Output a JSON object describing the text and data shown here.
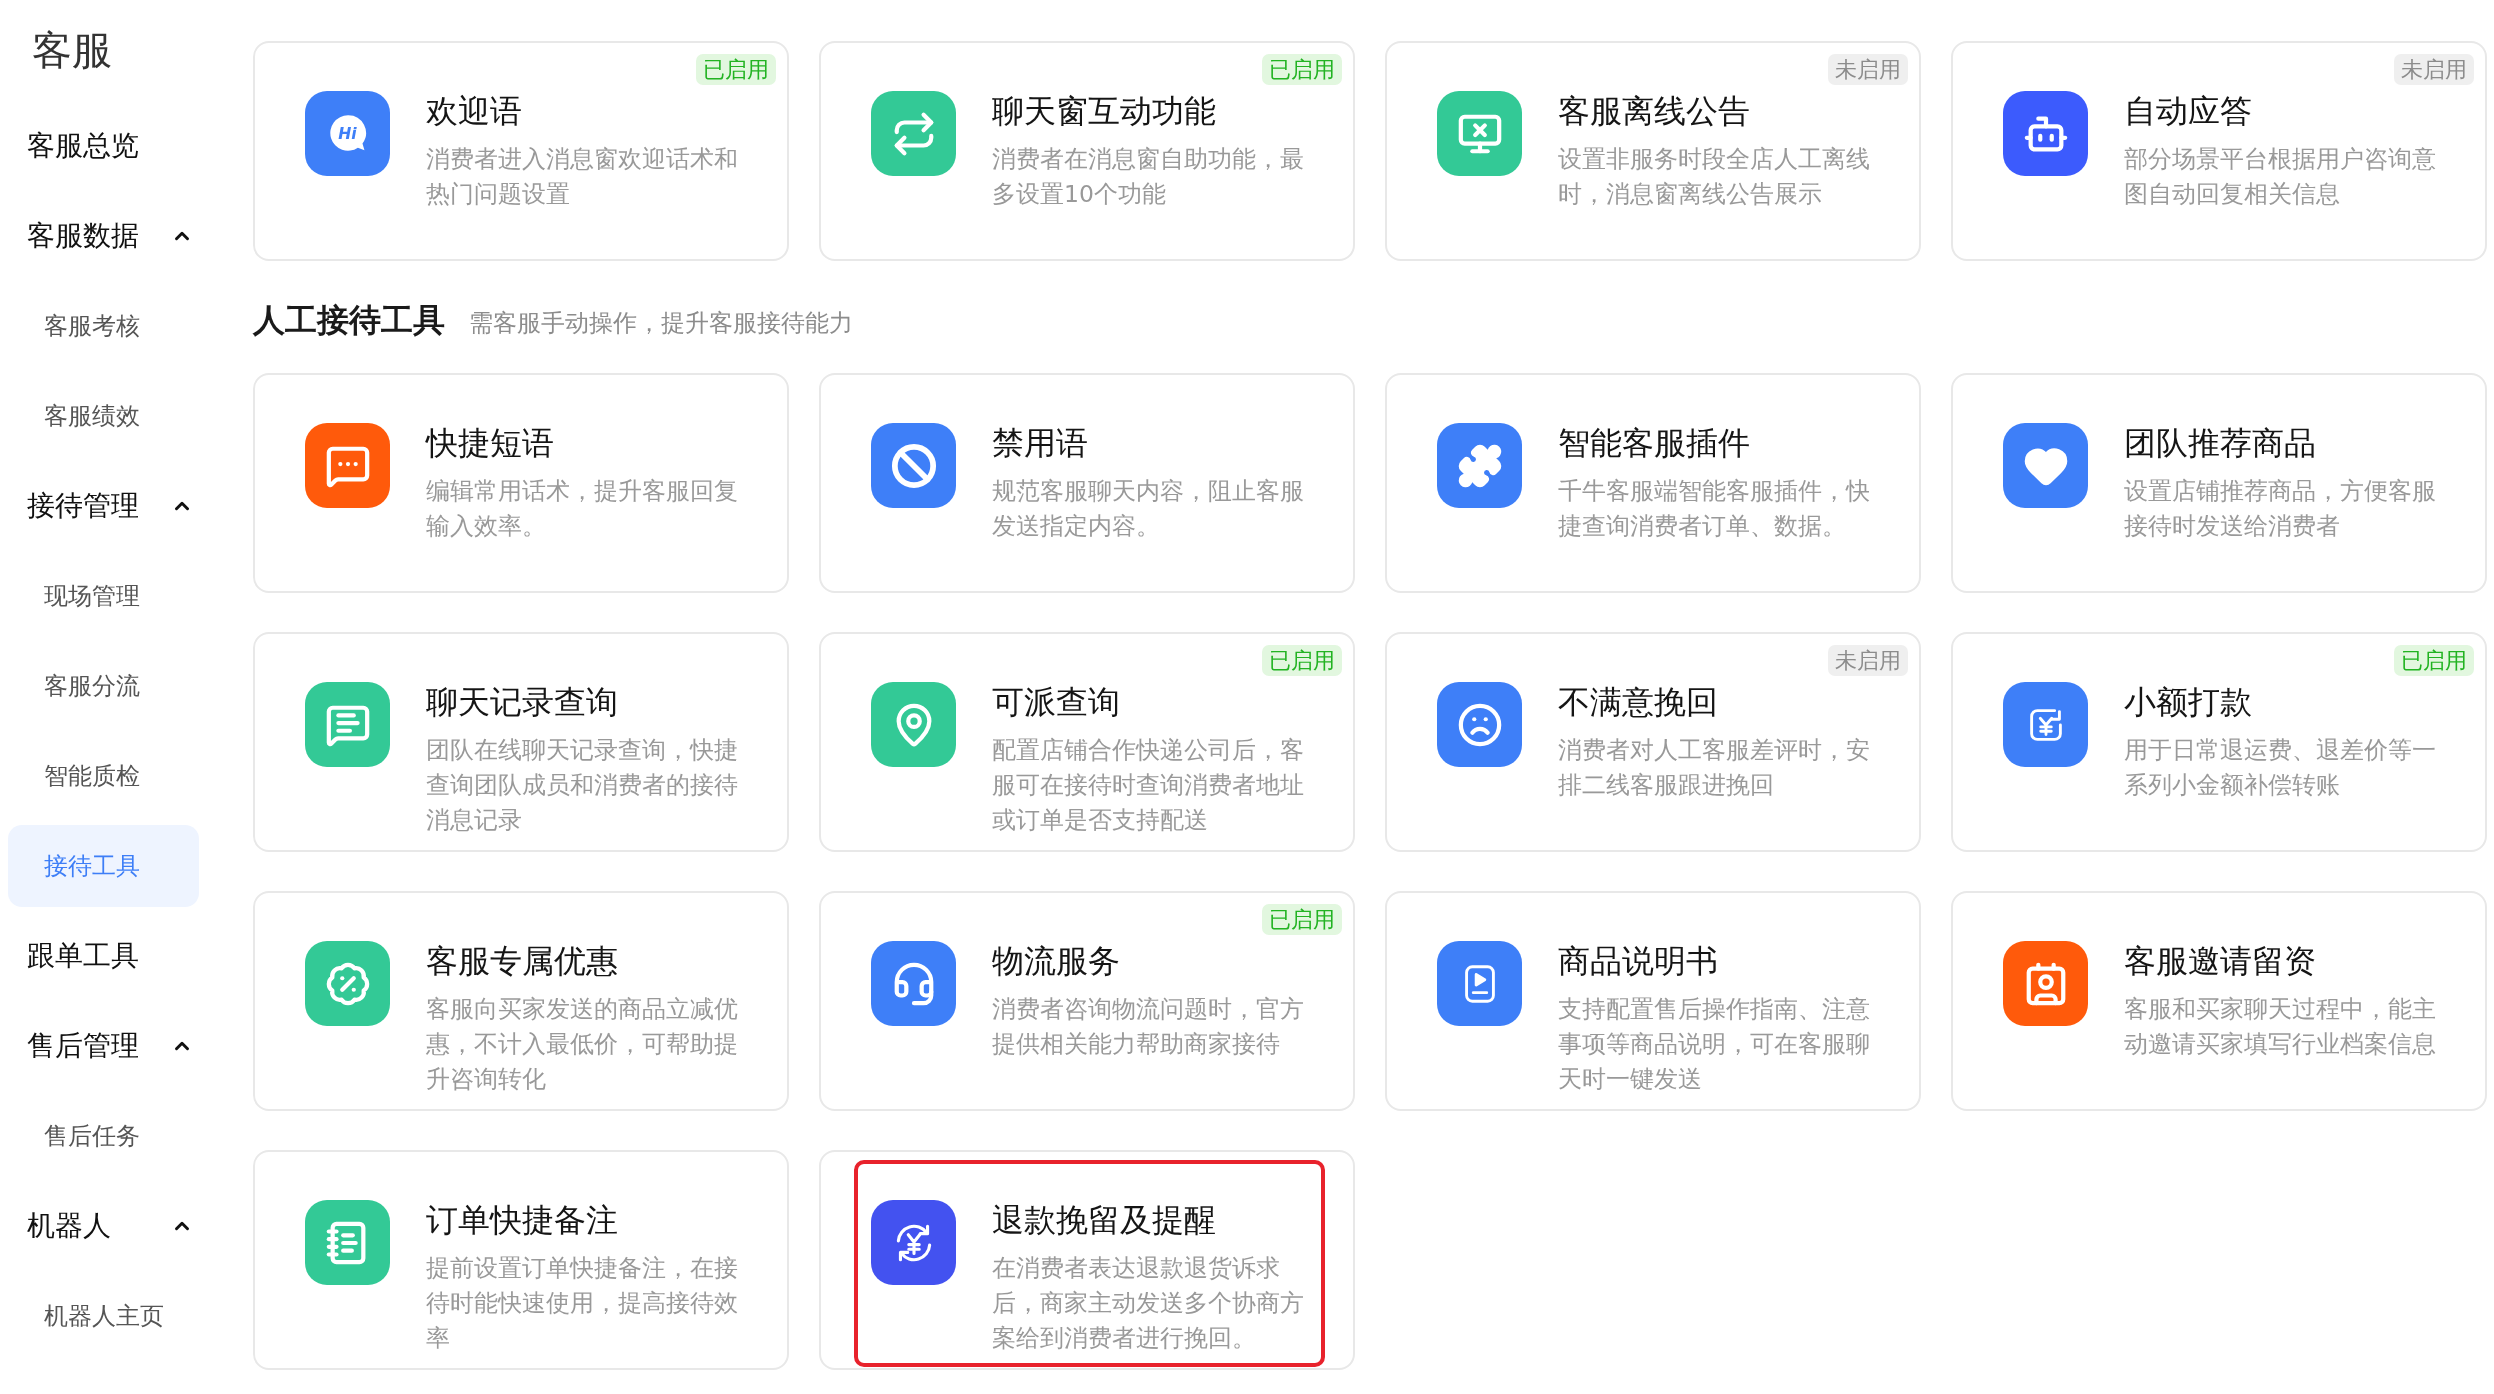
{
  "sidebar": {
    "title": "客服",
    "items": [
      {
        "kind": "link",
        "label": "客服总览",
        "selected": false
      },
      {
        "kind": "group",
        "label": "客服数据",
        "expanded": true,
        "children": [
          {
            "kind": "link",
            "label": "客服考核",
            "selected": false
          },
          {
            "kind": "link",
            "label": "客服绩效",
            "selected": false
          }
        ]
      },
      {
        "kind": "group",
        "label": "接待管理",
        "expanded": true,
        "children": [
          {
            "kind": "link",
            "label": "现场管理",
            "selected": false
          },
          {
            "kind": "link",
            "label": "客服分流",
            "selected": false
          },
          {
            "kind": "link",
            "label": "智能质检",
            "selected": false
          },
          {
            "kind": "link",
            "label": "接待工具",
            "selected": true
          }
        ]
      },
      {
        "kind": "link",
        "label": "跟单工具",
        "selected": false
      },
      {
        "kind": "group",
        "label": "售后管理",
        "expanded": true,
        "children": [
          {
            "kind": "link",
            "label": "售后任务",
            "selected": false
          }
        ]
      },
      {
        "kind": "group",
        "label": "机器人",
        "expanded": true,
        "children": [
          {
            "kind": "link",
            "label": "机器人主页",
            "selected": false
          }
        ]
      }
    ]
  },
  "auto_tools": [
    {
      "title": "欢迎语",
      "description": "消费者进入消息窗欢迎话术和热门问题设置",
      "color": "#3e7ff8",
      "icon_text": "Hi",
      "badge": "已启用",
      "enabled": true
    },
    {
      "title": "聊天窗互动功能",
      "description": "消费者在消息窗自助功能，最多设置10个功能",
      "color": "#33c996",
      "badge": "已启用",
      "enabled": true
    },
    {
      "title": "客服离线公告",
      "description": "设置非服务时段全店人工离线时，消息窗离线公告展示",
      "color": "#33c996",
      "badge": "未启用",
      "enabled": false
    },
    {
      "title": "自动应答",
      "description": "部分场景平台根据用户咨询意图自动回复相关信息",
      "color": "#3c5bfd",
      "badge": "未启用",
      "enabled": false
    }
  ],
  "manual_tools": {
    "title": "人工接待工具",
    "subtitle": "需客服手动操作，提升客服接待能力",
    "tools": [
      {
        "title": "快捷短语",
        "description": "编辑常用话术，提升客服回复输入效率。",
        "color": "#ff5a0b",
        "highlighted": false
      },
      {
        "title": "禁用语",
        "description": "规范客服聊天内容，阻止客服发送指定内容。",
        "color": "#3e7ff8",
        "highlighted": false
      },
      {
        "title": "智能客服插件",
        "description": "千牛客服端智能客服插件，快捷查询消费者订单、数据。",
        "color": "#3e7ff8",
        "highlighted": false
      },
      {
        "title": "团队推荐商品",
        "description": "设置店铺推荐商品，方便客服接待时发送给消费者",
        "color": "#3e7ff8",
        "highlighted": false
      },
      {
        "title": "聊天记录查询",
        "description": "团队在线聊天记录查询，快捷查询团队成员和消费者的接待消息记录",
        "color": "#33c996",
        "highlighted": false
      },
      {
        "title": "可派查询",
        "description": "配置店铺合作快递公司后，客服可在接待时查询消费者地址或订单是否支持配送",
        "color": "#33c996",
        "badge": "已启用",
        "enabled": true,
        "highlighted": false
      },
      {
        "title": "不满意挽回",
        "description": "消费者对人工客服差评时，安排二线客服跟进挽回",
        "color": "#3e7ff8",
        "badge": "未启用",
        "enabled": false,
        "highlighted": false
      },
      {
        "title": "小额打款",
        "description": "用于日常退运费、退差价等一系列小金额补偿转账",
        "color": "#3e7ff8",
        "badge": "已启用",
        "enabled": true,
        "highlighted": false
      },
      {
        "title": "客服专属优惠",
        "description": "客服向买家发送的商品立减优惠，不计入最低价，可帮助提升咨询转化",
        "color": "#33c996",
        "highlighted": false
      },
      {
        "title": "物流服务",
        "description": "消费者咨询物流问题时，官方提供相关能力帮助商家接待",
        "color": "#3e7ff8",
        "badge": "已启用",
        "enabled": true,
        "highlighted": false
      },
      {
        "title": "商品说明书",
        "description": "支持配置售后操作指南、注意事项等商品说明，可在客服聊天时一键发送",
        "color": "#3e7ff8",
        "highlighted": false
      },
      {
        "title": "客服邀请留资",
        "description": "客服和买家聊天过程中，能主动邀请买家填写行业档案信息",
        "color": "#ff5a0b",
        "highlighted": false
      },
      {
        "title": "订单快捷备注",
        "description": "提前设置订单快捷备注，在接待时能快速使用，提高接待效率",
        "color": "#33c996",
        "highlighted": false
      },
      {
        "title": "退款挽留及提醒",
        "description": "在消费者表达退款退货诉求后，商家主动发送多个协商方案给到消费者进行挽回。",
        "color": "#4352f0",
        "highlighted": true
      }
    ]
  }
}
